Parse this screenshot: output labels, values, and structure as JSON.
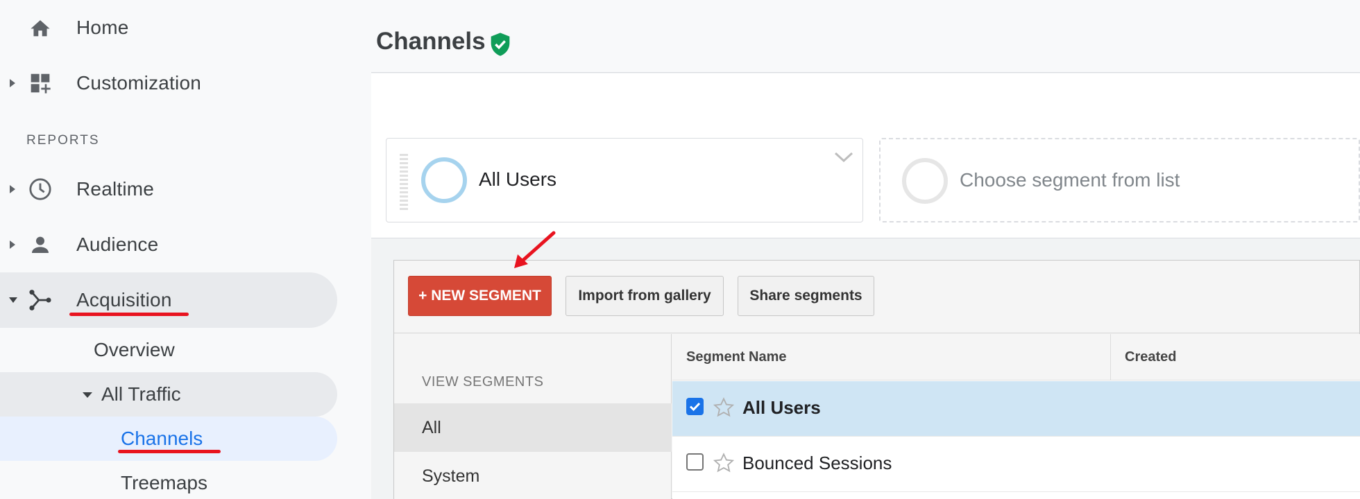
{
  "sidebar": {
    "items": [
      {
        "label": "Home",
        "icon": "home-icon"
      },
      {
        "label": "Customization",
        "icon": "dashboard-add-icon"
      }
    ],
    "section_title": "REPORTS",
    "reports": [
      {
        "label": "Realtime",
        "icon": "clock-icon"
      },
      {
        "label": "Audience",
        "icon": "person-icon"
      },
      {
        "label": "Acquisition",
        "icon": "acquisition-icon"
      }
    ],
    "acquisition_children": {
      "overview": "Overview",
      "all_traffic": "All Traffic",
      "channels": "Channels",
      "treemaps": "Treemaps"
    }
  },
  "header": {
    "title": "Channels"
  },
  "segments": {
    "active": "All Users",
    "empty_placeholder": "Choose segment from list"
  },
  "panel": {
    "new_segment_label": "+ NEW SEGMENT",
    "import_label": "Import from gallery",
    "share_label": "Share segments",
    "view_title": "VIEW SEGMENTS",
    "views": [
      "All",
      "System"
    ],
    "columns": {
      "name": "Segment Name",
      "created": "Created"
    },
    "rows": [
      {
        "name": "All Users",
        "checked": true
      },
      {
        "name": "Bounced Sessions",
        "checked": false
      }
    ]
  },
  "colors": {
    "new_segment": "#d64937",
    "annotation_red": "#e8131f",
    "selected_row": "#cfe5f4",
    "verified_green": "#0f9d58",
    "link_blue": "#1a73e8"
  }
}
